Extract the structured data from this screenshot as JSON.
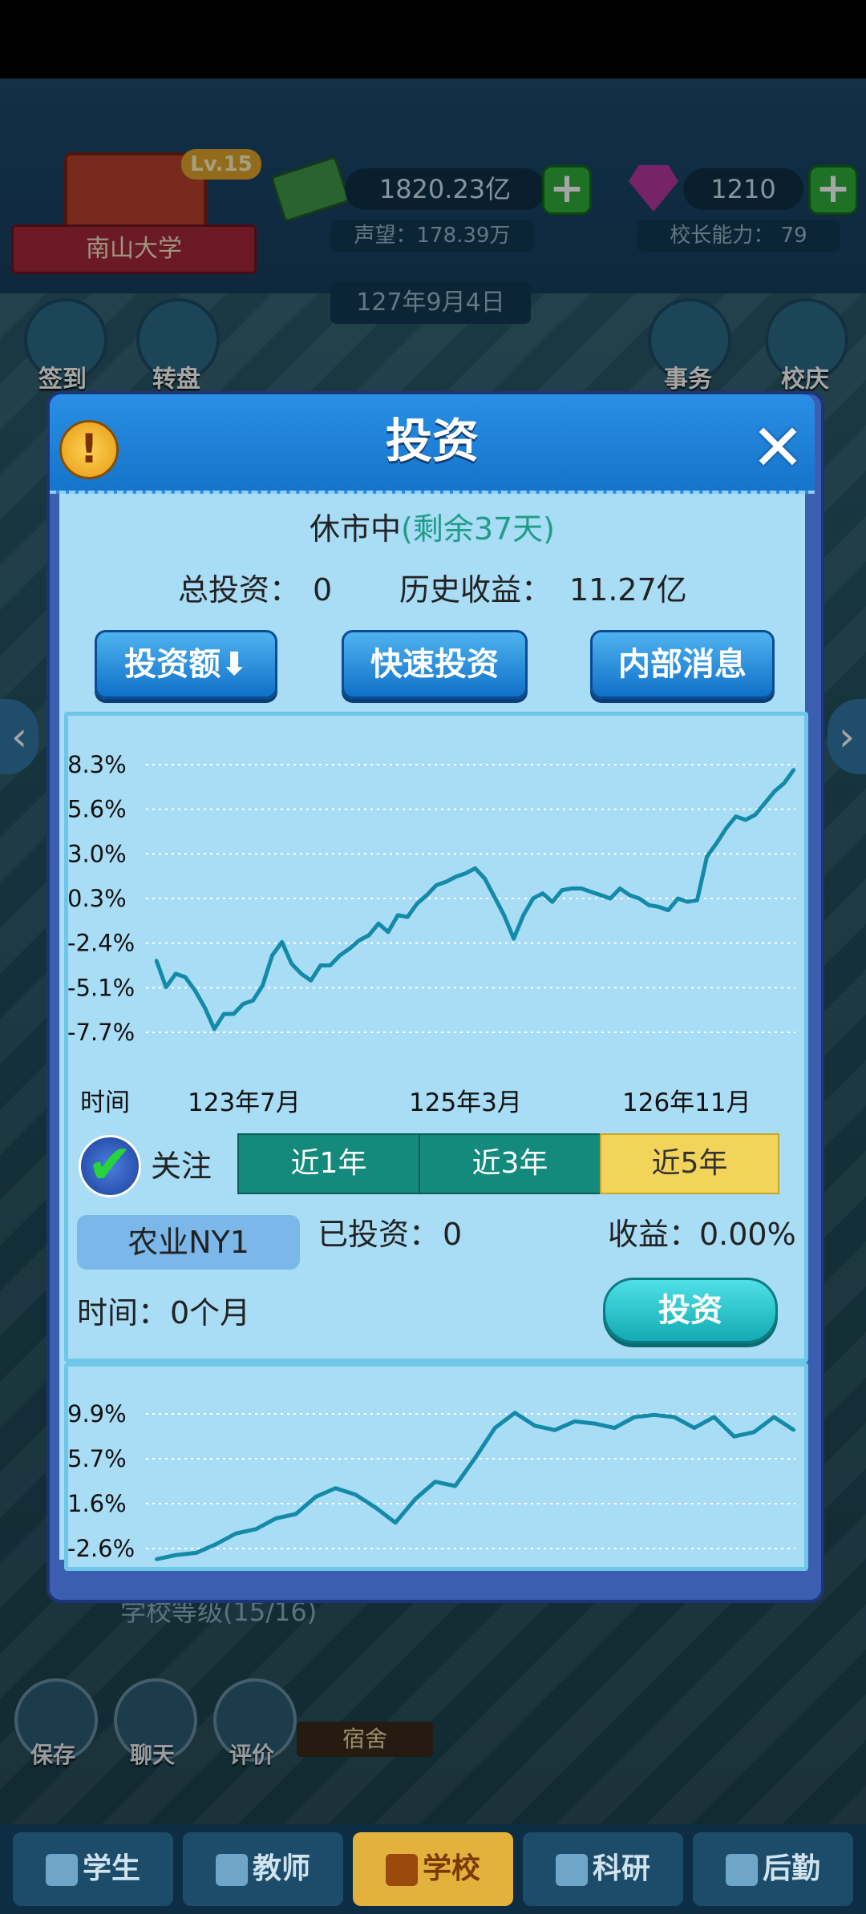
{
  "header": {
    "school_name": "南山大学",
    "level": "Lv.15",
    "money": "1820.23亿",
    "gems": "1210",
    "reputation": "声望：178.39万",
    "principal_ability": "校长能力：  79",
    "date": "127年9月4日"
  },
  "quick_buttons": [
    {
      "label": "签到"
    },
    {
      "label": "转盘"
    },
    {
      "label": "事务"
    },
    {
      "label": "校庆"
    }
  ],
  "dialog": {
    "title": "投资",
    "market_status": "休市中",
    "market_remaining": "(剩余37天)",
    "total_investment_label": "总投资：",
    "total_investment_value": "0",
    "history_profit_label": "历史收益：",
    "history_profit_value": "11.27亿",
    "buttons": {
      "amount": "投资额⬇",
      "quick": "快速投资",
      "insider": "内部消息"
    },
    "fund": {
      "follow_label": "关注",
      "ranges": [
        "近1年",
        "近3年",
        "近5年"
      ],
      "active_range": "近5年",
      "name": "农业NY1",
      "invested_label": "已投资：",
      "invested_value": "0",
      "profit_label": "收益：",
      "profit_value": "0.00%",
      "time_label": "时间：",
      "time_value": "0个月",
      "invest_button": "投资"
    }
  },
  "chart_data": [
    {
      "type": "line",
      "x_axis_label": "时间",
      "x_ticks": [
        "123年7月",
        "125年3月",
        "126年11月"
      ],
      "y_ticks": [
        "8.3%",
        "5.6%",
        "3.0%",
        "0.3%",
        "-2.4%",
        "-5.1%",
        "-7.7%"
      ],
      "ylim": [
        -7.7,
        8.3
      ],
      "grid": true,
      "values": [
        -3.4,
        -5.0,
        -4.2,
        -4.4,
        -5.2,
        -6.2,
        -7.5,
        -6.6,
        -6.6,
        -6.0,
        -5.8,
        -4.9,
        -3.1,
        -2.3,
        -3.6,
        -4.2,
        -4.6,
        -3.7,
        -3.7,
        -3.1,
        -2.7,
        -2.2,
        -1.9,
        -1.2,
        -1.7,
        -0.7,
        -0.8,
        0.0,
        0.5,
        1.1,
        1.3,
        1.6,
        1.8,
        2.1,
        1.5,
        0.4,
        -0.7,
        -2.1,
        -0.7,
        0.3,
        0.6,
        0.1,
        0.8,
        0.9,
        0.9,
        0.7,
        0.5,
        0.3,
        0.9,
        0.5,
        0.3,
        -0.1,
        -0.2,
        -0.4,
        0.3,
        0.1,
        0.2,
        2.8,
        3.6,
        4.5,
        5.2,
        5.0,
        5.3,
        6.0,
        6.7,
        7.2,
        8.0
      ]
    },
    {
      "type": "line",
      "y_ticks": [
        "9.9%",
        "5.7%",
        "1.6%",
        "-2.6%"
      ],
      "ylim": [
        -2.6,
        9.9
      ],
      "grid": true,
      "values": [
        -3.6,
        -3.2,
        -3.0,
        -2.2,
        -1.2,
        -0.8,
        0.2,
        0.6,
        2.2,
        3.0,
        2.4,
        1.2,
        -0.2,
        2.0,
        3.6,
        3.2,
        5.8,
        8.6,
        10.0,
        8.8,
        8.4,
        9.2,
        9.0,
        8.6,
        9.6,
        9.8,
        9.6,
        8.6,
        9.6,
        7.8,
        8.2,
        9.6,
        8.4
      ]
    }
  ],
  "below_dialog": {
    "school_level_text": "学校等级(15/16)",
    "dorm_label": "宿舍",
    "bottom_buttons": [
      "保存",
      "聊天",
      "评价"
    ]
  },
  "navbar": {
    "items": [
      "学生",
      "教师",
      "学校",
      "科研",
      "后勤"
    ],
    "active": "学校"
  }
}
